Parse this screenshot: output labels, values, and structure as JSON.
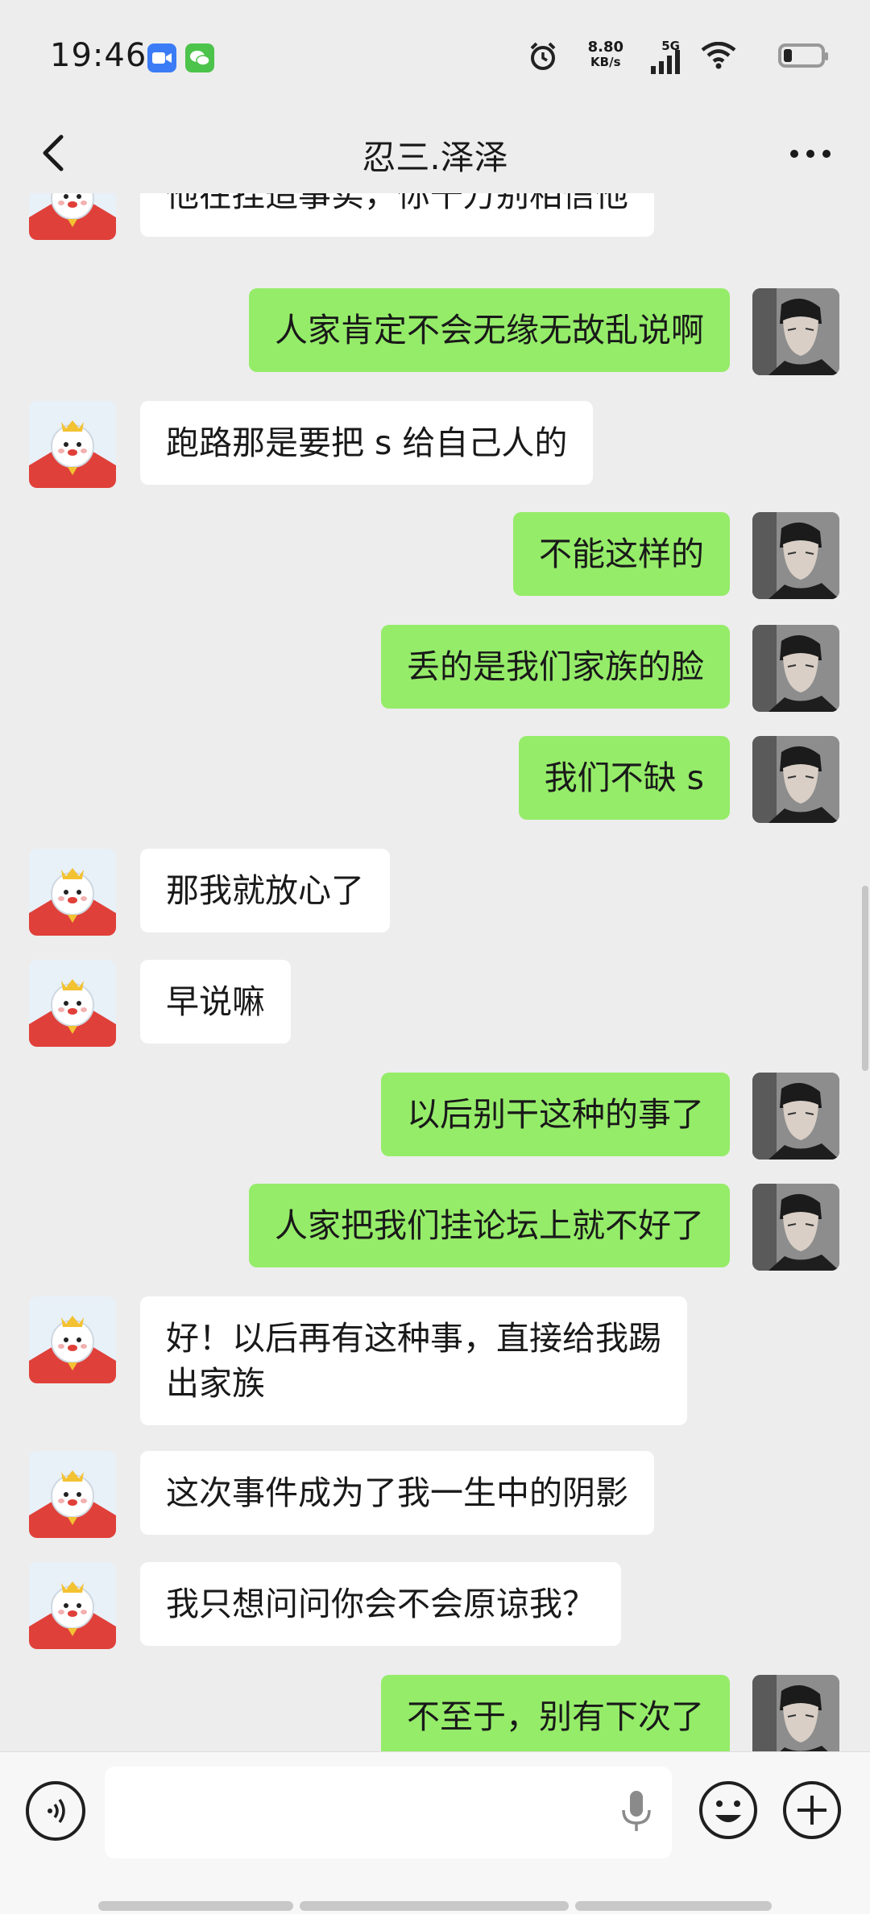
{
  "status_bar": {
    "time": "19:46",
    "net_speed_value": "8.80",
    "net_speed_unit": "KB/s",
    "network": "5G",
    "battery_level": 0.2
  },
  "title_bar": {
    "title": "忍三.泽泽"
  },
  "messages": [
    {
      "sender": "friend",
      "text": "他在捏造事实，你千万别相信他"
    },
    {
      "sender": "me",
      "text": "人家肯定不会无缘无故乱说啊"
    },
    {
      "sender": "friend",
      "text": "跑路那是要把 s 给自己人的"
    },
    {
      "sender": "me",
      "text": "不能这样的"
    },
    {
      "sender": "me",
      "text": "丢的是我们家族的脸"
    },
    {
      "sender": "me",
      "text": "我们不缺 s"
    },
    {
      "sender": "friend",
      "text": "那我就放心了"
    },
    {
      "sender": "friend",
      "text": "早说嘛"
    },
    {
      "sender": "me",
      "text": "以后别干这种的事了"
    },
    {
      "sender": "me",
      "text": "人家把我们挂论坛上就不好了"
    },
    {
      "sender": "friend",
      "text": "好！以后再有这种事，直接给我踢\n出家族"
    },
    {
      "sender": "friend",
      "text": "这次事件成为了我一生中的阴影"
    },
    {
      "sender": "friend",
      "text": "我只想问问你会不会原谅我？"
    },
    {
      "sender": "me",
      "text": "不至于，别有下次了"
    }
  ],
  "input_bar": {
    "input_value": "",
    "icons": [
      "voice-icon",
      "mic-icon",
      "emoji-icon",
      "plus-icon"
    ]
  },
  "colors": {
    "background": "#ededed",
    "my_bubble": "#95ec69",
    "friend_bubble": "#ffffff"
  }
}
